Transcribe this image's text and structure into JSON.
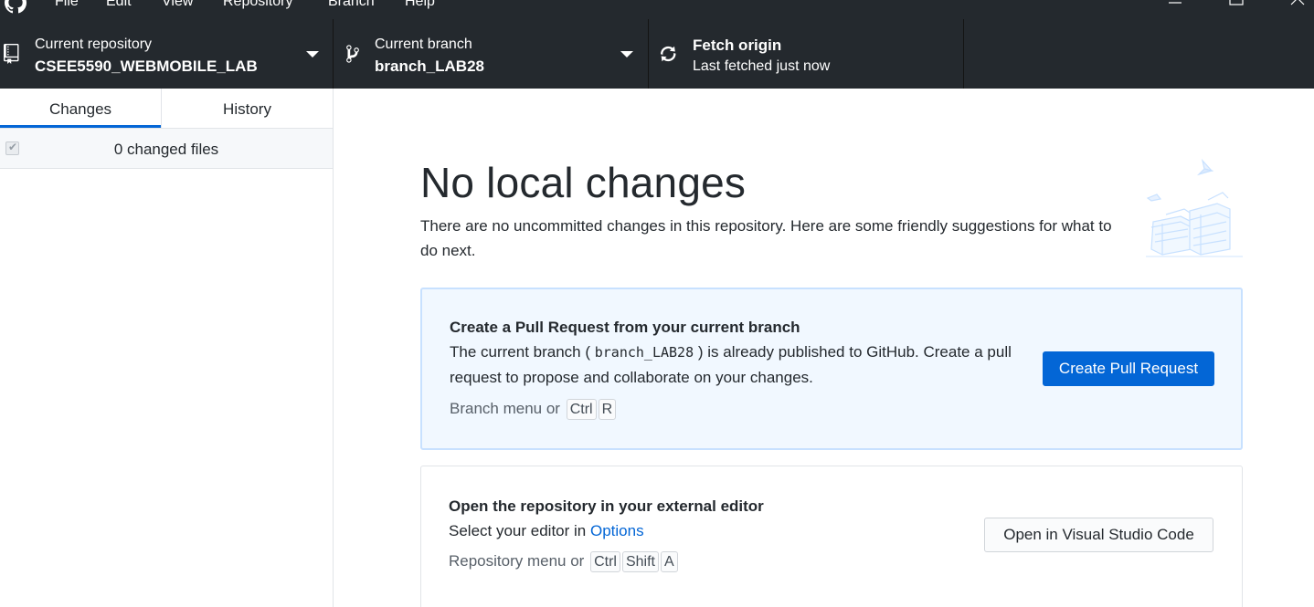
{
  "menu": {
    "items": [
      "File",
      "Edit",
      "View",
      "Repository",
      "Branch",
      "Help"
    ]
  },
  "toolbar": {
    "repository": {
      "caption": "Current repository",
      "value": "CSEE5590_WEBMOBILE_LAB"
    },
    "branch": {
      "caption": "Current branch",
      "value": "branch_LAB28"
    },
    "fetch": {
      "title": "Fetch origin",
      "subtitle": "Last fetched just now"
    }
  },
  "sidebar": {
    "tabs": [
      {
        "label": "Changes",
        "active": true
      },
      {
        "label": "History",
        "active": false
      }
    ],
    "changed_files": "0 changed files"
  },
  "main": {
    "heading": "No local changes",
    "description": "There are no uncommitted changes in this repository. Here are some friendly suggestions for what to do next.",
    "pull_request_card": {
      "title": "Create a Pull Request from your current branch",
      "body_pre": "The current branch (",
      "branch": "branch_LAB28",
      "body_post": ") is already published to GitHub. Create a pull request to propose and collaborate on your changes.",
      "hint": "Branch menu or",
      "keys": [
        "Ctrl",
        "R"
      ],
      "button": "Create Pull Request"
    },
    "editor_card": {
      "title": "Open the repository in your external editor",
      "body_pre": "Select your editor in",
      "link": "Options",
      "hint": "Repository menu or",
      "keys": [
        "Ctrl",
        "Shift",
        "A"
      ],
      "button": "Open in Visual Studio Code"
    }
  },
  "colors": {
    "toolbar_bg": "#24292e",
    "accent": "#0366d6",
    "pr_card_bg": "#f1f8ff"
  }
}
